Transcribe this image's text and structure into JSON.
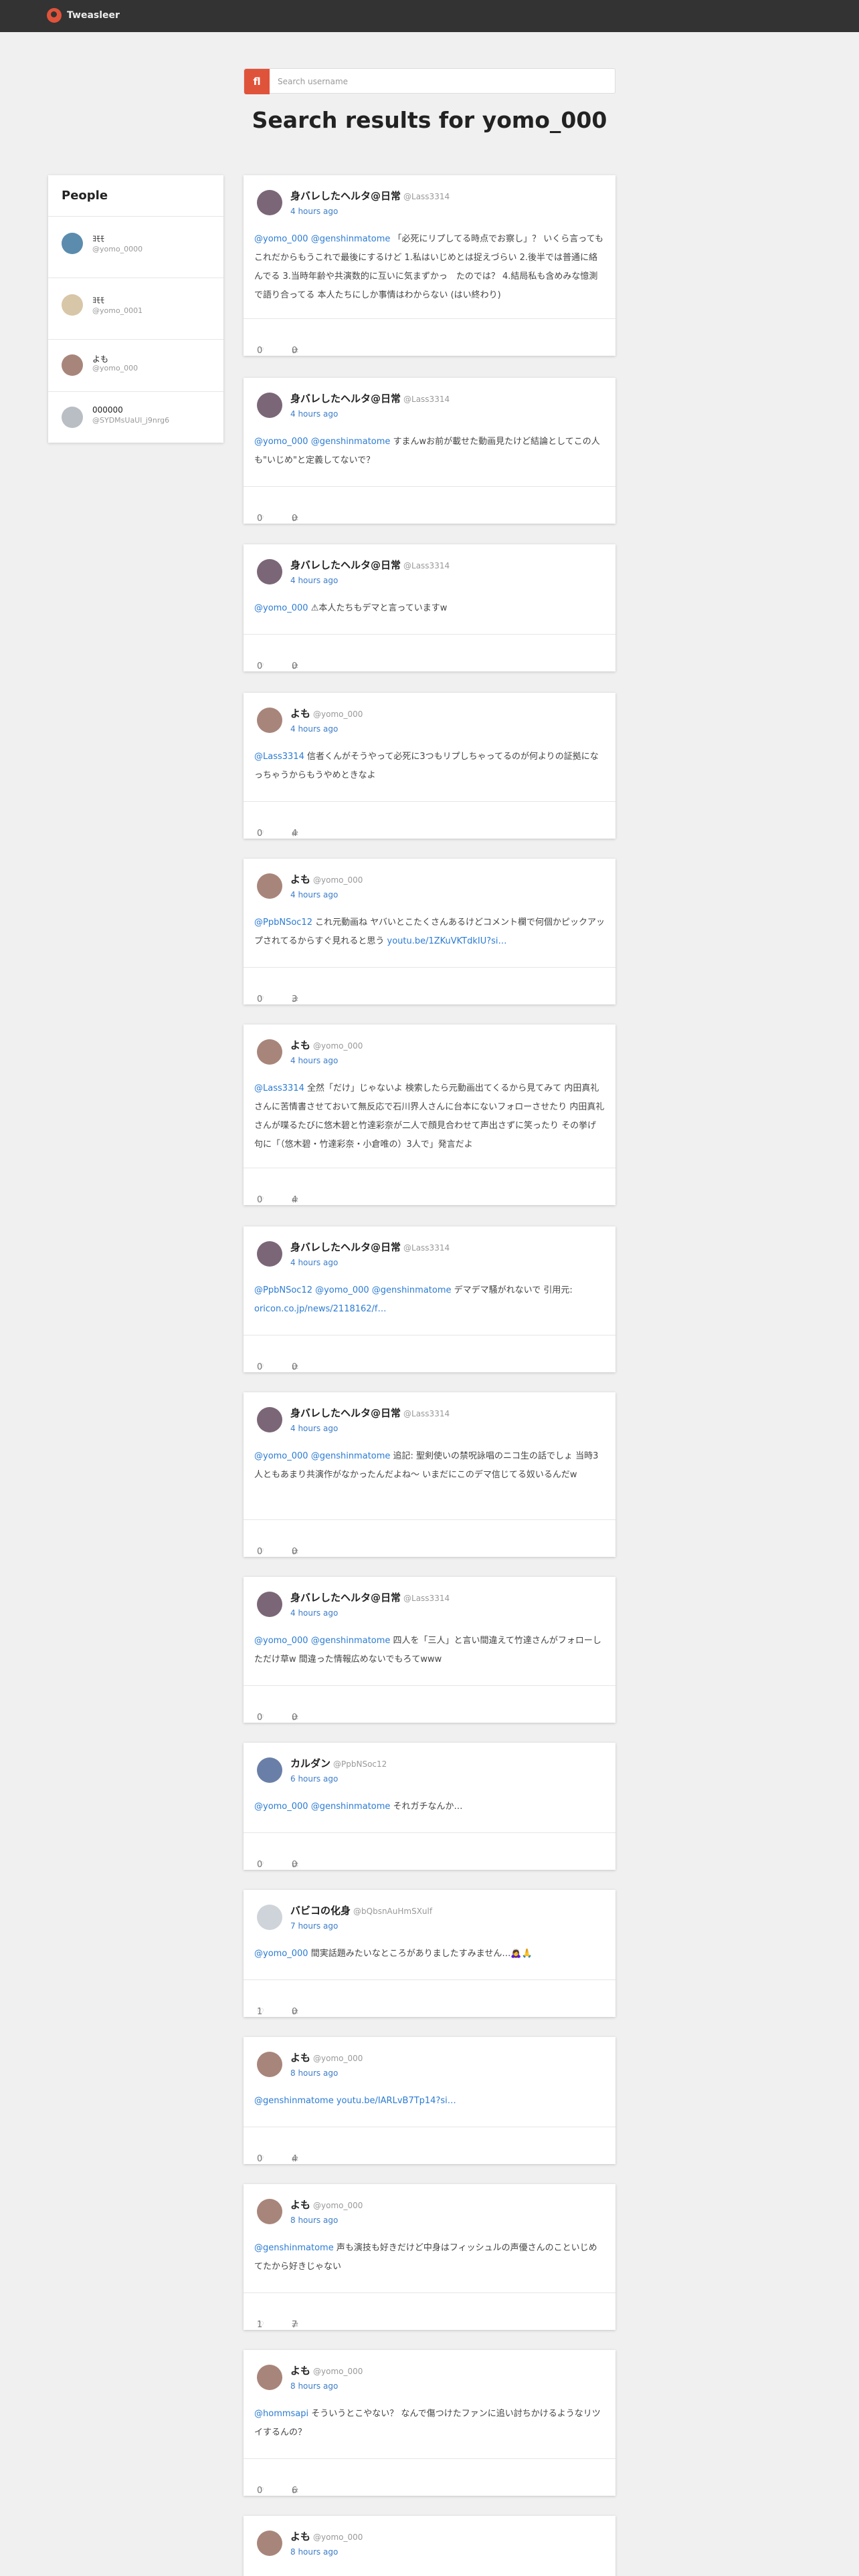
{
  "app": {
    "name": "Tweasleer"
  },
  "search": {
    "button_label": "fl",
    "placeholder": "Search username"
  },
  "page_title": "Search results for yomo_000",
  "people": {
    "title": "People",
    "items": [
      {
        "name": "ﾖﾓﾓ",
        "handle": "@yomo_0000",
        "avatar_color": "#5b8cae"
      },
      {
        "name": "ﾖﾓﾓ",
        "handle": "@yomo_0001",
        "avatar_color": "#d8c6a8"
      },
      {
        "name": "よも",
        "handle": "@yomo_000",
        "avatar_color": "#a8857a"
      },
      {
        "name": "000000",
        "handle": "@SYDMsUaUl_j9nrg6",
        "avatar_color": "#b9bec4"
      }
    ]
  },
  "tweets": [
    {
      "name": "身バレしたヘルタ@日常",
      "handle": "@Lass3314",
      "time": "4 hours ago",
      "avatar_color": "#7b6678",
      "mentions": "@yomo_000 @genshinmatome",
      "text": " 「必死にリプしてる時点でお察し」？ いくら言ってもこれだからもうこれで最後にするけど 1.私はいじめとは捉えづらい 2.後半では普通に絡んでる 3.当時年齢や共演数的に互いに気まずかっ　たのでは？ 4.結局私も含めみな憶測で語り合ってる 本人たちにしか事情はわからない (はい終わり)",
      "likes": "0",
      "retweets": "0"
    },
    {
      "name": "身バレしたヘルタ@日常",
      "handle": "@Lass3314",
      "time": "4 hours ago",
      "avatar_color": "#7b6678",
      "mentions": "@yomo_000 @genshinmatome",
      "text": " すまんwお前が載せた動画見たけど結論としてこの人も\"いじめ\"と定義してないで？",
      "likes": "0",
      "retweets": "0"
    },
    {
      "name": "身バレしたヘルタ@日常",
      "handle": "@Lass3314",
      "time": "4 hours ago",
      "avatar_color": "#7b6678",
      "mentions": "@yomo_000",
      "text": " ⚠本人たちもデマと言っていますw",
      "likes": "0",
      "retweets": "0"
    },
    {
      "name": "よも",
      "handle": "@yomo_000",
      "time": "4 hours ago",
      "avatar_color": "#a8857a",
      "mentions": "@Lass3314",
      "text": " 信者くんがそうやって必死に3つもリプしちゃってるのが何よりの証拠になっちゃうからもうやめときなよ",
      "likes": "0",
      "retweets": "4"
    },
    {
      "name": "よも",
      "handle": "@yomo_000",
      "time": "4 hours ago",
      "avatar_color": "#a8857a",
      "mentions": "@PpbNSoc12",
      "text": " これ元動画ね ヤバいとこたくさんあるけどコメント欄で何個かピックアップされてるからすぐ見れると思う",
      "link": "youtu.be/1ZKuVKTdkIU?si…",
      "likes": "0",
      "retweets": "3"
    },
    {
      "name": "よも",
      "handle": "@yomo_000",
      "time": "4 hours ago",
      "avatar_color": "#a8857a",
      "mentions": "@Lass3314",
      "text": " 全然「だけ」じゃないよ 検索したら元動画出てくるから見てみて 内田真礼さんに苦情書させておいて無反応で石川界人さんに台本にないフォローさせたり 内田真礼さんが喋るたびに悠木碧と竹達彩奈が二人で顔見合わせて声出さずに笑ったり その挙げ句に「（悠木碧・竹達彩奈・小倉唯の）3人で」発言だよ",
      "likes": "0",
      "retweets": "4"
    },
    {
      "name": "身バレしたヘルタ@日常",
      "handle": "@Lass3314",
      "time": "4 hours ago",
      "avatar_color": "#7b6678",
      "mentions": "@PpbNSoc12 @yomo_000 @genshinmatome",
      "text": " デマデマ騒がれないで 引用元:",
      "link": "oricon.co.jp/news/2118162/f…",
      "likes": "0",
      "retweets": "0"
    },
    {
      "name": "身バレしたヘルタ@日常",
      "handle": "@Lass3314",
      "time": "4 hours ago",
      "avatar_color": "#7b6678",
      "mentions": "@yomo_000 @genshinmatome",
      "text": " 追記: 聖剣使いの禁呪詠唱のニコ生の話でしょ 当時3人ともあまり共演作がなかったんだよね〜 いまだにこのデマ信じてる奴いるんだw",
      "likes": "0",
      "retweets": "0"
    },
    {
      "name": "身バレしたヘルタ@日常",
      "handle": "@Lass3314",
      "time": "4 hours ago",
      "avatar_color": "#7b6678",
      "mentions": "@yomo_000 @genshinmatome",
      "text": " 四人を「三人」と言い間違えて竹達さんがフォローしただけ草w 間違った情報広めないでもろてwww",
      "likes": "0",
      "retweets": "0"
    },
    {
      "name": "カルダン",
      "handle": "@PpbNSoc12",
      "time": "6 hours ago",
      "avatar_color": "#6a7fa8",
      "mentions": "@yomo_000 @genshinmatome",
      "text": " それガチなんか…",
      "likes": "0",
      "retweets": "0"
    },
    {
      "name": "バビコの化身",
      "handle": "@bQbsnAuHmSXulf",
      "time": "7 hours ago",
      "avatar_color": "#cfd4da",
      "mentions": "@yomo_000",
      "text": " 間実話題みたいなところがありましたすみません…🙇‍♀️🙏",
      "likes": "1",
      "retweets": "0"
    },
    {
      "name": "よも",
      "handle": "@yomo_000",
      "time": "8 hours ago",
      "avatar_color": "#a8857a",
      "mentions": "@genshinmatome",
      "text": "",
      "link": "youtu.be/IARLvB7Tp14?si…",
      "likes": "0",
      "retweets": "4"
    },
    {
      "name": "よも",
      "handle": "@yomo_000",
      "time": "8 hours ago",
      "avatar_color": "#a8857a",
      "mentions": "@genshinmatome",
      "text": " 声も演技も好きだけど中身はフィッシュルの声優さんのこといじめてたから好きじゃない",
      "likes": "1",
      "retweets": "7"
    },
    {
      "name": "よも",
      "handle": "@yomo_000",
      "time": "8 hours ago",
      "avatar_color": "#a8857a",
      "mentions": "@hommsapi",
      "text": " そういうとこやない？ なんで傷つけたファンに追い討ちかけるようなリツイするんの？",
      "likes": "0",
      "retweets": "6"
    },
    {
      "name": "よも",
      "handle": "@yomo_000",
      "time": "8 hours ago",
      "avatar_color": "#a8857a",
      "mentions": "",
      "text": "",
      "likes": "",
      "retweets": ""
    }
  ]
}
